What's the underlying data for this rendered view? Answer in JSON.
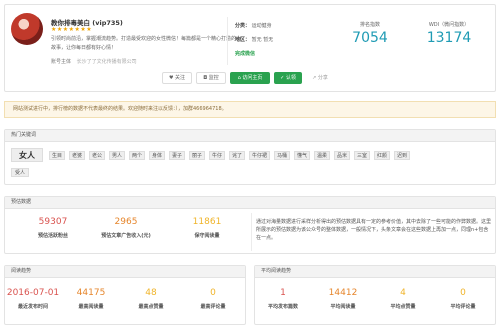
{
  "profile": {
    "name": "教你排毒美白 (vip735)",
    "tag": "⁢",
    "stars": "★★★★★★★",
    "description": "引领时尚前沿，掌握潮流趋势。打造最受欢迎的女性微信！每篇都是一个精心打造的小故事，让你每日都有好心情！",
    "account_label": "账号主体",
    "account_value": "长沙了了文化传播有限公司",
    "category_label": "分类：",
    "category_value": "运动健身",
    "region_label": "地区：",
    "region_value": "暂无 暂无",
    "certified": "完成微信"
  },
  "metrics": {
    "rank_label": "排名指数",
    "rank_value": "7054",
    "wdi_label": "WDI（微问指数）",
    "wdi_value": "13174"
  },
  "actions": {
    "follow": "关注",
    "monitor": "监控",
    "visit": "访问主页",
    "claim": "认领",
    "share": "分享"
  },
  "notice": "网站测试进行中，排行榜的数据不代表最终的结果。欢迎随时来注以反馈：），加群466964718。",
  "hot_keywords": {
    "title": "热门关键词",
    "main": "女人",
    "row1": [
      "生目",
      "老婆",
      "老公",
      "男人",
      "两个",
      "身体",
      "妻子",
      "丽子",
      "牛仔",
      "诧了",
      "牛仔裙",
      "马桶",
      "懂气",
      "温柔",
      "品米",
      "三室",
      "红颜",
      "迟到"
    ],
    "row2": [
      "受人"
    ]
  },
  "estimate": {
    "title": "预估数据",
    "stats": [
      {
        "value": "59307",
        "label": "预估活跃粉丝",
        "color": "red"
      },
      {
        "value": "2965",
        "label": "预估文章广告收入(元)",
        "color": "orange"
      },
      {
        "value": "11861",
        "label": "保守阅读量",
        "color": "yellow"
      }
    ],
    "note": "通过对海量数据进行采样分析得出的预估数据具有一定的参考价值，其中去除了一些可能的作弊数据。这里所展示的预估数据为该公众号的整体数据，一般情况下，头条文章会在这些数据上再加一点，同理n+包含在一点。"
  },
  "reading": {
    "title": "阅读趋势",
    "stats": [
      {
        "value": "2016-07-01",
        "label": "最近发布时间",
        "color": "red"
      },
      {
        "value": "44175",
        "label": "最高阅读量",
        "color": "orange"
      },
      {
        "value": "48",
        "label": "最高点赞量",
        "color": "yellow"
      },
      {
        "value": "0",
        "label": "最高评论量",
        "color": "yellow"
      }
    ]
  },
  "average": {
    "title": "平均阅读趋势",
    "stats": [
      {
        "value": "1",
        "label": "平均发布篇数",
        "color": "red"
      },
      {
        "value": "14412",
        "label": "平均阅读量",
        "color": "orange"
      },
      {
        "value": "4",
        "label": "平均点赞量",
        "color": "yellow"
      },
      {
        "value": "0",
        "label": "平均评论量",
        "color": "yellow"
      }
    ]
  }
}
